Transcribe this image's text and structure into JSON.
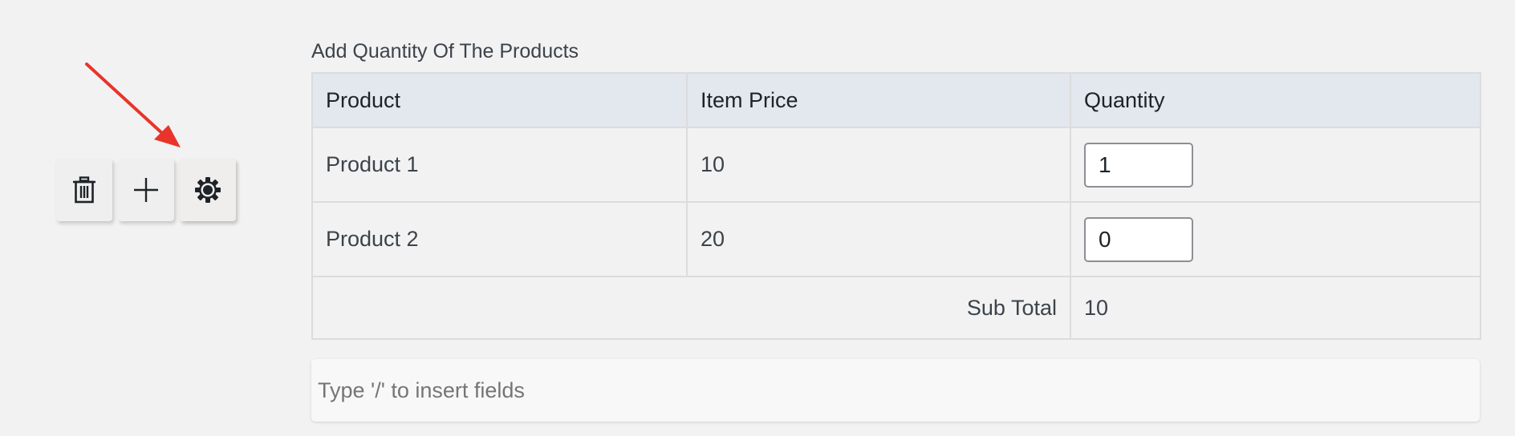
{
  "toolbar": {
    "buttons": [
      {
        "icon": "trash-icon"
      },
      {
        "icon": "plus-icon"
      },
      {
        "icon": "gear-icon"
      }
    ],
    "annotation_arrow_color": "#e8342b"
  },
  "field": {
    "label": "Add Quantity Of The Products",
    "columns": [
      "Product",
      "Item Price",
      "Quantity"
    ],
    "rows": [
      {
        "product": "Product 1",
        "price": "10",
        "quantity": "1"
      },
      {
        "product": "Product 2",
        "price": "20",
        "quantity": "0"
      }
    ],
    "subtotal_label": "Sub Total",
    "subtotal_value": "10"
  },
  "inserter": {
    "placeholder": "Type '/' to insert fields"
  },
  "colors": {
    "header_bg": "#e3e7ee",
    "border": "#dcdcde",
    "background": "#f2f2f2"
  }
}
